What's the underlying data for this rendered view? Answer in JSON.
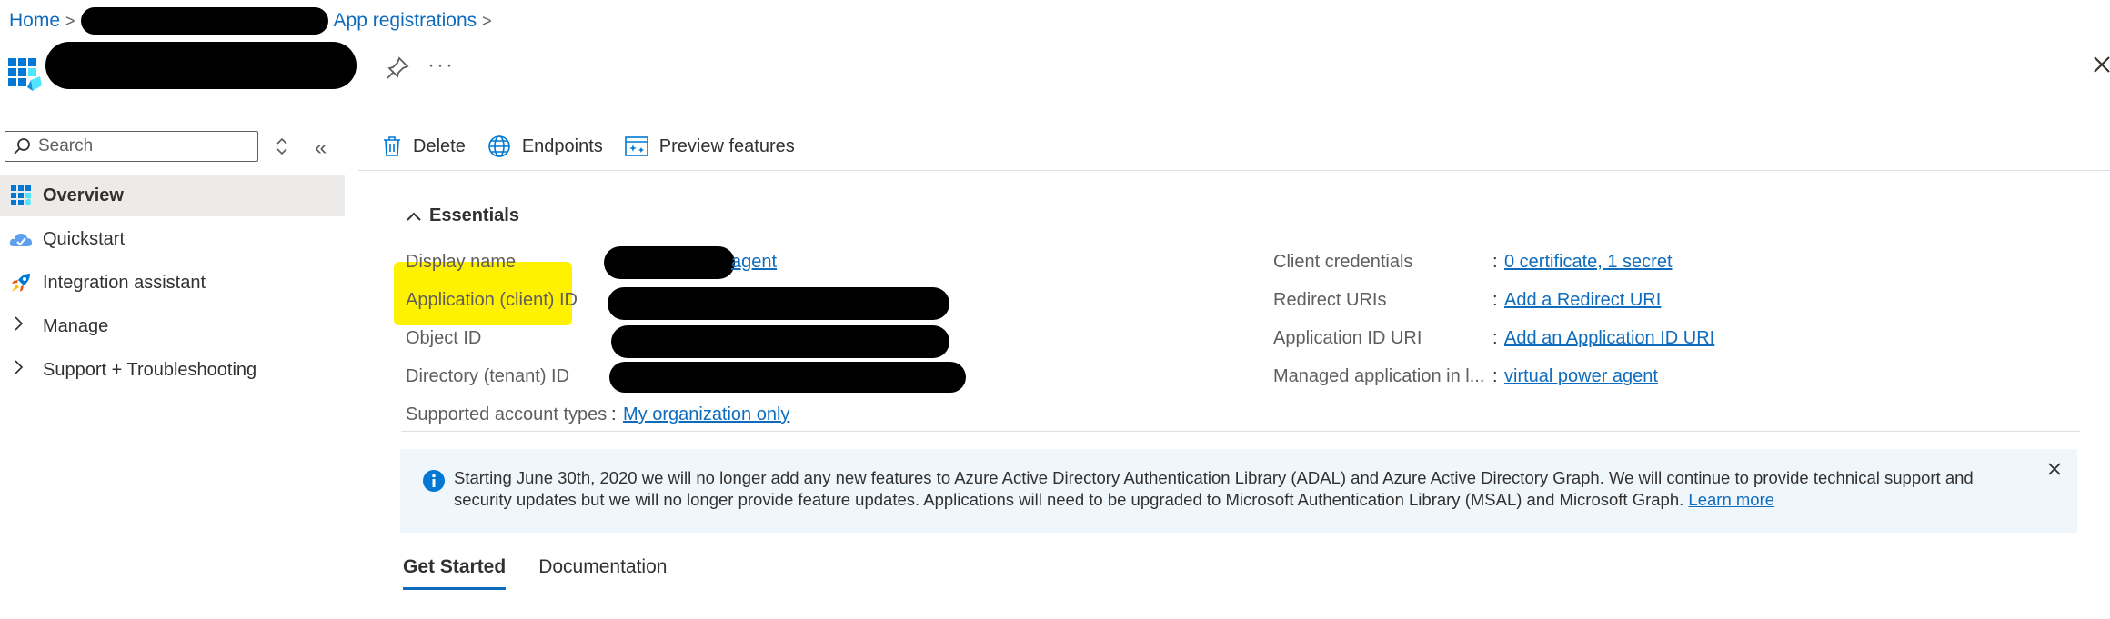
{
  "breadcrumb": {
    "home": "Home",
    "current": "App registrations",
    "separator": ">"
  },
  "header": {
    "more": "···"
  },
  "sidebar": {
    "search_placeholder": "Search",
    "items": [
      {
        "label": "Overview",
        "icon": "overview-grid-icon",
        "selected": true
      },
      {
        "label": "Quickstart",
        "icon": "quickstart-cloud-icon"
      },
      {
        "label": "Integration assistant",
        "icon": "rocket-icon"
      },
      {
        "label": "Manage",
        "icon": "chevron-right-icon",
        "expandable": true
      },
      {
        "label": "Support + Troubleshooting",
        "icon": "chevron-right-icon",
        "expandable": true
      }
    ]
  },
  "commands": {
    "delete": "Delete",
    "endpoints": "Endpoints",
    "preview": "Preview features"
  },
  "essentials": {
    "title": "Essentials",
    "left": [
      {
        "label": "Display name",
        "value_visible": "agent"
      },
      {
        "label": "Application (client) ID"
      },
      {
        "label": "Object ID"
      },
      {
        "label": "Directory (tenant) ID"
      },
      {
        "label": "Supported account types",
        "value": "My organization only"
      }
    ],
    "right": [
      {
        "label": "Client credentials",
        "value": "0 certificate, 1 secret"
      },
      {
        "label": "Redirect URIs",
        "value": "Add a Redirect URI"
      },
      {
        "label": "Application ID URI",
        "value": "Add an Application ID URI"
      },
      {
        "label": "Managed application in l...",
        "value": "virtual power agent"
      }
    ],
    "colon": ":"
  },
  "banner": {
    "text": "Starting June 30th, 2020 we will no longer add any new features to Azure Active Directory Authentication Library (ADAL) and Azure Active Directory Graph. We will continue to provide technical support and security updates but we will no longer provide feature updates. Applications will need to be upgraded to Microsoft Authentication Library (MSAL) and Microsoft Graph.",
    "link": "Learn more"
  },
  "tabs": [
    {
      "label": "Get Started",
      "active": true
    },
    {
      "label": "Documentation"
    }
  ],
  "colors": {
    "accent": "#0f6cbd",
    "highlight": "#fff200",
    "banner_bg": "#eff6fc",
    "selected_bg": "#edebe9"
  }
}
